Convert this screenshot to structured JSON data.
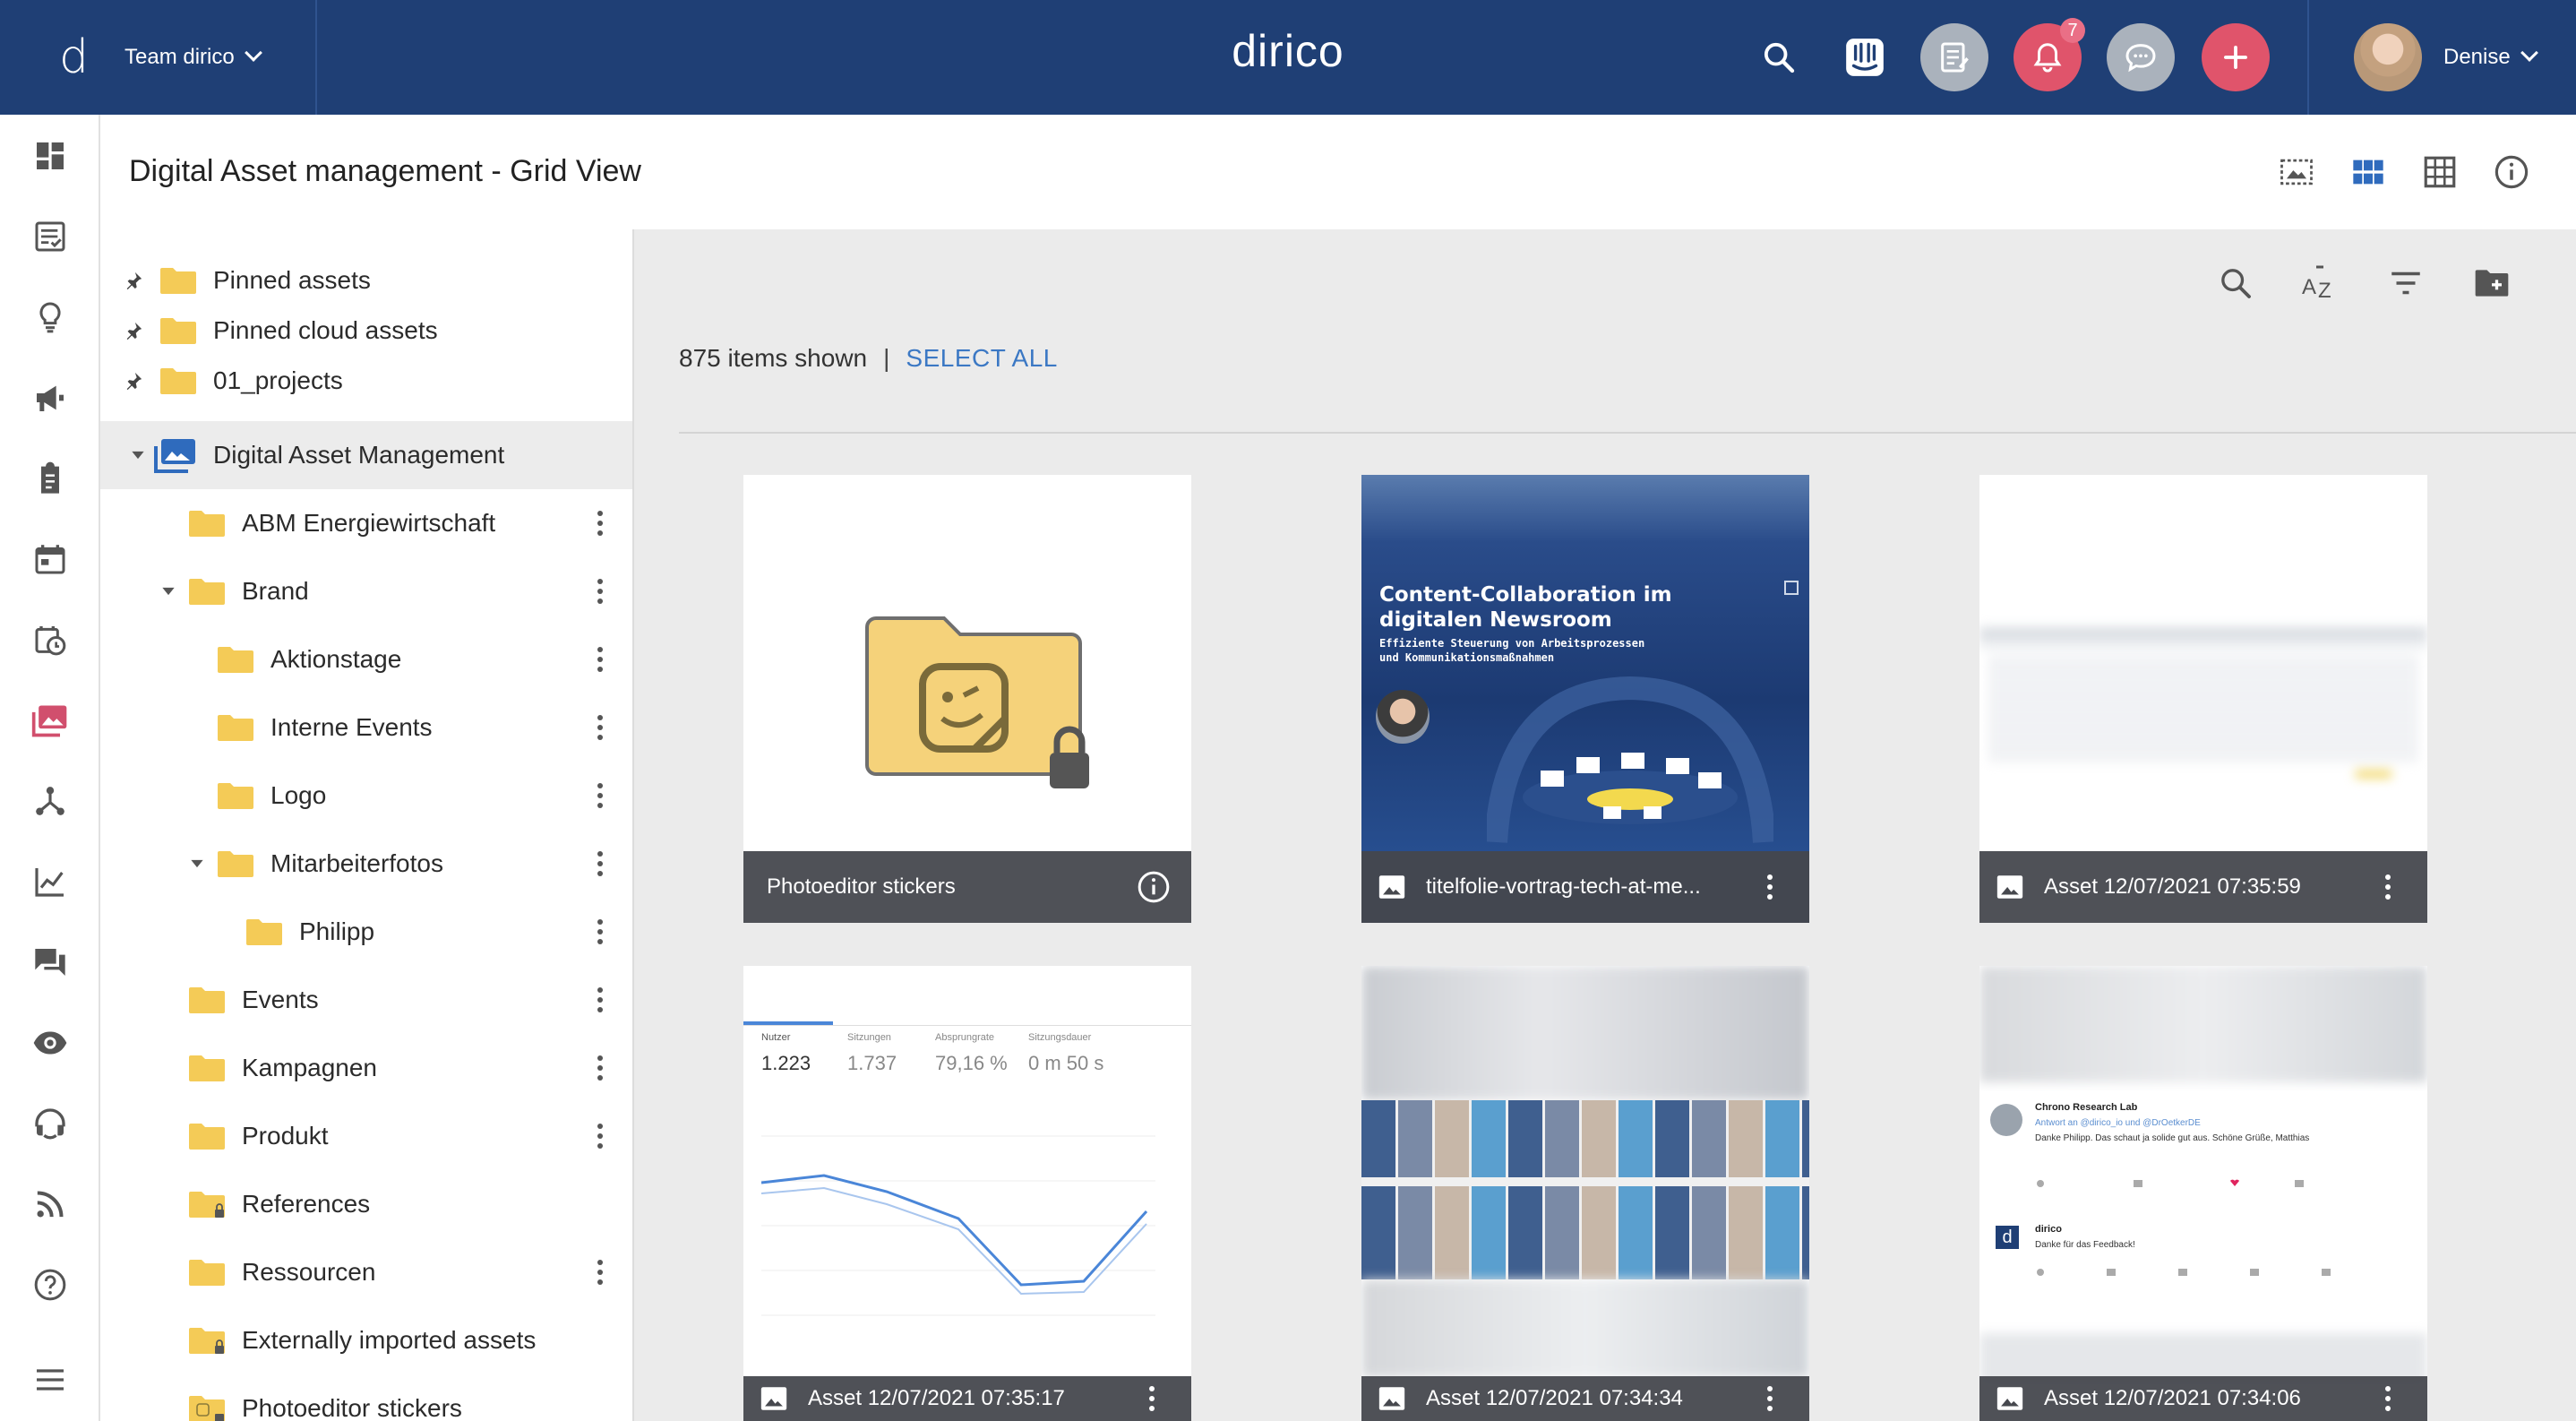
{
  "topbar": {
    "team": "Team dirico",
    "brand": "dirico",
    "notifications_count": "7",
    "user_name": "Denise",
    "colors": {
      "bar": "#1f3f75",
      "accent": "#e0546b",
      "grey_button": "#aab2bc"
    },
    "icons": [
      "search-icon",
      "intercom-icon",
      "notes-icon",
      "bell-icon",
      "chat-icon",
      "plus-icon"
    ]
  },
  "rail": {
    "icons": [
      "dashboard-icon",
      "checklist-icon",
      "lightbulb-icon",
      "megaphone-icon",
      "clipboard-icon",
      "calendar-icon",
      "calendar-clock-icon",
      "images-icon",
      "network-icon",
      "chart-icon",
      "forum-icon",
      "eye-icon",
      "headset-icon",
      "rss-icon",
      "help-icon",
      "menu-icon"
    ],
    "active": "images-icon"
  },
  "header": {
    "title": "Digital Asset management - Grid View",
    "view_icons": [
      "slideshow-icon",
      "grid-view-icon",
      "table-view-icon",
      "info-icon"
    ],
    "active_view": "grid-view-icon"
  },
  "tree": {
    "pinned": [
      {
        "label": "Pinned assets"
      },
      {
        "label": "Pinned cloud assets"
      },
      {
        "label": "01_projects"
      }
    ],
    "root": "Digital Asset Management",
    "items": [
      {
        "label": "ABM Energiewirtschaft",
        "level": 1,
        "menu": true
      },
      {
        "label": "Brand",
        "level": 1,
        "expanded": true,
        "menu": true
      },
      {
        "label": "Aktionstage",
        "level": 2,
        "menu": true
      },
      {
        "label": "Interne Events",
        "level": 2,
        "menu": true
      },
      {
        "label": "Logo",
        "level": 2,
        "menu": true
      },
      {
        "label": "Mitarbeiterfotos",
        "level": 2,
        "expanded": true,
        "menu": true
      },
      {
        "label": "Philipp",
        "level": 3,
        "menu": true
      },
      {
        "label": "Events",
        "level": 1,
        "menu": true
      },
      {
        "label": "Kampagnen",
        "level": 1,
        "menu": true
      },
      {
        "label": "Produkt",
        "level": 1,
        "menu": true
      },
      {
        "label": "References",
        "level": 1,
        "locked": true,
        "menu": false
      },
      {
        "label": "Ressourcen",
        "level": 1,
        "menu": true
      },
      {
        "label": "Externally imported assets",
        "level": 1,
        "locked": true,
        "menu": false
      },
      {
        "label": "Photoeditor stickers",
        "level": 1,
        "sticker": true,
        "menu": false
      }
    ]
  },
  "toolbar": {
    "icons": [
      "search-icon",
      "sort-az-icon",
      "filter-icon",
      "new-folder-icon"
    ],
    "count_text": "875 items shown",
    "separator": "|",
    "select_all": "SELECT ALL"
  },
  "cards": [
    {
      "caption": "Photoeditor stickers",
      "kind": "folder"
    },
    {
      "caption": "titelfolie-vortrag-tech-at-me...",
      "kind": "image",
      "slide": {
        "title_line1": "Content-Collaboration im",
        "title_line2": "digitalen Newsroom",
        "subtitle_line1": "Effiziente Steuerung von Arbeitsprozessen",
        "subtitle_line2": "und Kommunikationsmaßnahmen"
      }
    },
    {
      "caption": "Asset 12/07/2021 07:35:59",
      "kind": "image"
    },
    {
      "caption": "Asset 12/07/2021 07:35:17",
      "kind": "image",
      "stats": {
        "labels": [
          "Nutzer",
          "Sitzungen",
          "Absprungrate",
          "Sitzungsdauer"
        ],
        "values": [
          "1.223",
          "1.737",
          "79,16 %",
          "0 m 50 s"
        ]
      }
    },
    {
      "caption": "Asset 12/07/2021 07:34:34",
      "kind": "image"
    },
    {
      "caption": "Asset 12/07/2021 07:34:06",
      "kind": "image",
      "tweet": {
        "author": "Chrono Research Lab",
        "reply_to": "Antwort an @dirico_io und @DrOetkerDE",
        "text": "Danke Philipp. Das schaut ja solide gut aus. Schöne Grüße, Matthias",
        "reply_author": "dirico",
        "reply_text": "Danke für das Feedback!"
      }
    }
  ]
}
